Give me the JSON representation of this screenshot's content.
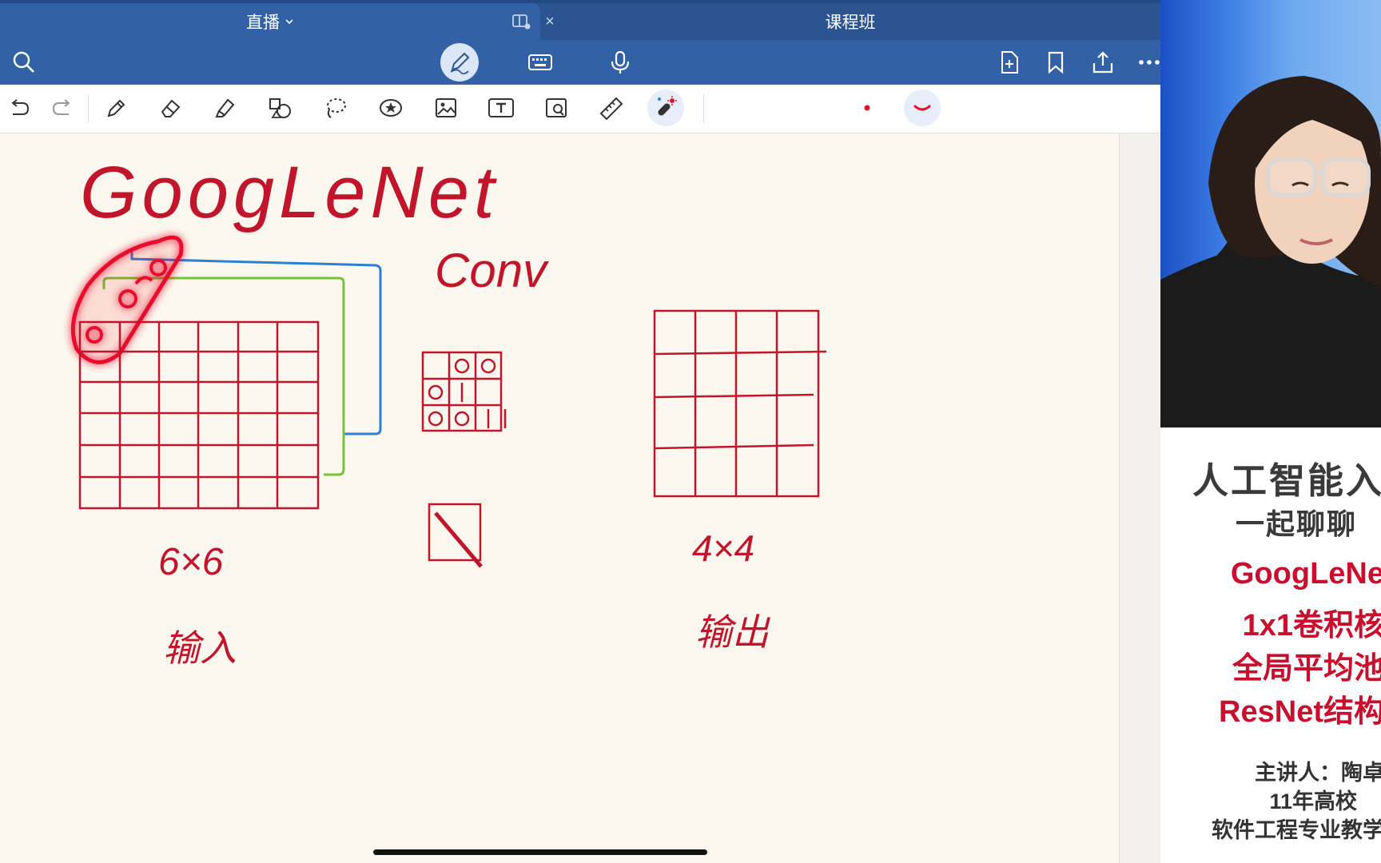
{
  "tabs": [
    {
      "label": "直播",
      "active": true
    },
    {
      "label": "课程班",
      "active": false
    }
  ],
  "tab_close_glyph": "×",
  "toolbar": {
    "left": [
      "search-icon"
    ],
    "center": [
      "pen-mode-icon",
      "keyboard-icon",
      "microphone-icon"
    ],
    "right": [
      "add-page-icon",
      "bookmark-icon",
      "share-icon",
      "more-icon"
    ]
  },
  "tools": [
    "undo-icon",
    "redo-icon",
    "pen-icon",
    "eraser-icon",
    "highlighter-icon",
    "shapes-icon",
    "lasso-icon",
    "sticker-icon",
    "image-icon",
    "textbox-icon",
    "zoom-window-icon",
    "ruler-icon",
    "laser-pointer-icon"
  ],
  "colors": {
    "accent": "#3262a5",
    "ink": "#c0152a",
    "laser": "#e8102a",
    "blue_ink": "#2d7fd0",
    "green_ink": "#76c23a",
    "paper": "#fcf8ef"
  },
  "handwriting": {
    "title": "GoogLeNet",
    "conv": "Conv",
    "input_size": "6×6",
    "input_label": "输入",
    "output_size": "4×4",
    "output_label": "输出"
  },
  "caption": {
    "title": "人工智能入",
    "subtitle": "一起聊聊",
    "topics": [
      "GoogLeNe",
      "1x1卷积核",
      "全局平均池",
      "ResNet结构"
    ],
    "speaker": "主讲人：陶卓",
    "years": "11年高校",
    "role": "软件工程专业教学"
  }
}
